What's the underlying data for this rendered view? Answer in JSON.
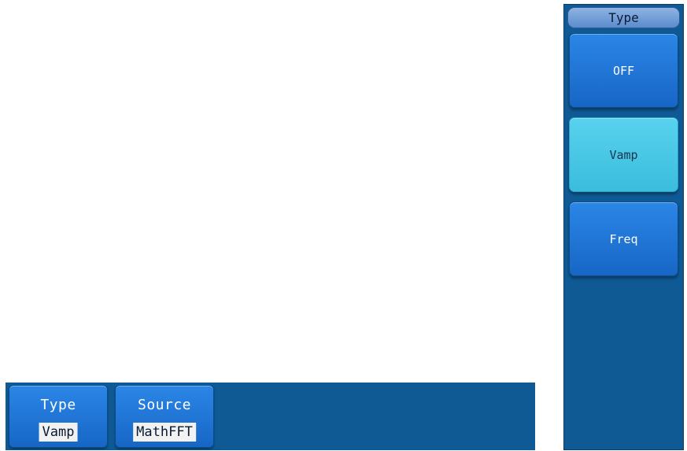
{
  "side_menu": {
    "title": "Type",
    "options": [
      {
        "label": "OFF",
        "selected": false
      },
      {
        "label": "Vamp",
        "selected": true
      },
      {
        "label": "Freq",
        "selected": false
      }
    ]
  },
  "bottom_menu": {
    "type": {
      "label": "Type",
      "value": "Vamp"
    },
    "source": {
      "label": "Source",
      "value": "MathFFT"
    }
  },
  "colors": {
    "panel_bg": "#0f5a95",
    "button_blue": "#1f77d9",
    "selected_cyan": "#49c8e6",
    "value_bg": "#f2f2f2"
  }
}
